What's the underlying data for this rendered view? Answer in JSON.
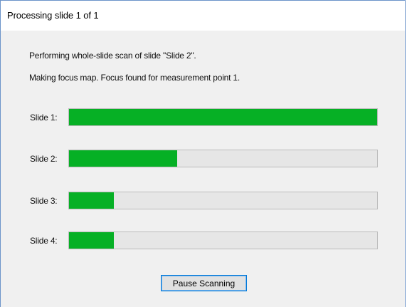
{
  "window": {
    "title": "Processing slide 1 of 1"
  },
  "status": {
    "line1": "Performing whole-slide scan of slide \"Slide 2\".",
    "line2": "Making focus map. Focus found for measurement point 1."
  },
  "slides": [
    {
      "label": "Slide 1:",
      "progress": 1.0
    },
    {
      "label": "Slide 2:",
      "progress": 0.35
    },
    {
      "label": "Slide 3:",
      "progress": 0.145
    },
    {
      "label": "Slide 4:",
      "progress": 0.145
    }
  ],
  "buttons": {
    "pause_label": "Pause Scanning"
  },
  "colors": {
    "progress_fill": "#06b025",
    "progress_track": "#e6e6e6",
    "button_focus_border": "#0078d7"
  }
}
